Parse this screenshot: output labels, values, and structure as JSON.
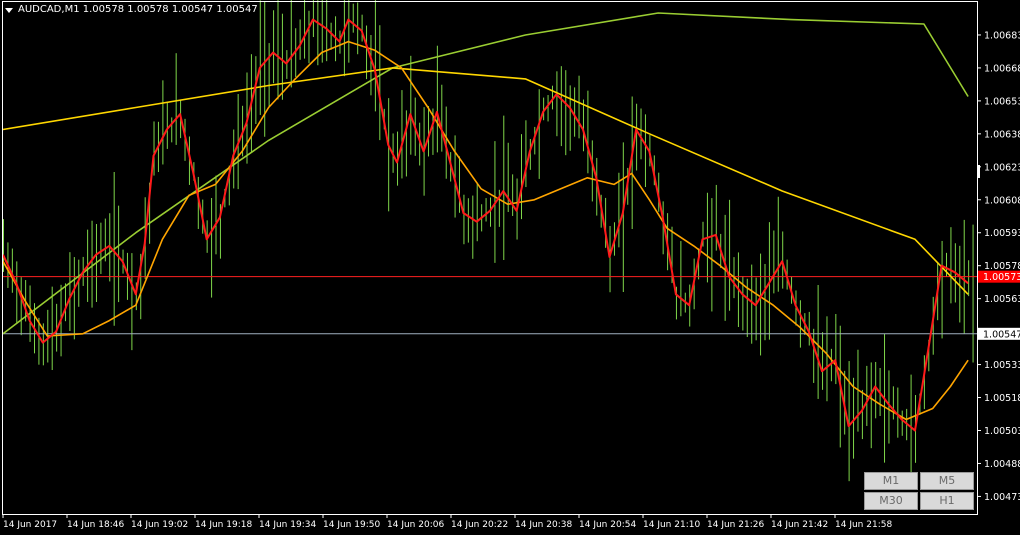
{
  "header": {
    "symbol": "AUDCAD,M1",
    "ohlc": "1.00578 1.00578 1.00547 1.00547"
  },
  "timeframes": [
    "M1",
    "M5",
    "M30",
    "H1"
  ],
  "colors": {
    "background": "#000000",
    "bars": "#7fd64a",
    "grid_frame": "#ffffff",
    "ma_fast": "#ff1a1a",
    "ma_mid": "#ffa500",
    "ma_slow": "#ffd700",
    "ma_long": "#9acd32",
    "bid_line": "#ff2020",
    "ask_line": "#a0b0c0"
  },
  "chart_data": {
    "type": "line",
    "title": "AUDCAD,M1",
    "y_ticks": [
      "1.00683",
      "1.00668",
      "1.00653",
      "1.00638",
      "1.00623",
      "1.00608",
      "1.00593",
      "1.00578",
      "1.00563",
      "1.00547",
      "1.00533",
      "1.00518",
      "1.00503",
      "1.00488",
      "1.00473"
    ],
    "ylim": [
      1.00465,
      1.00698
    ],
    "x_tick_labels": [
      "14 Jun 2017",
      "14 Jun 18:46",
      "14 Jun 19:02",
      "14 Jun 19:18",
      "14 Jun 19:34",
      "14 Jun 19:50",
      "14 Jun 20:06",
      "14 Jun 20:22",
      "14 Jun 20:38",
      "14 Jun 20:54",
      "14 Jun 21:10",
      "14 Jun 21:26",
      "14 Jun 21:42",
      "14 Jun 21:58"
    ],
    "current_bid": 1.00573,
    "current_bid_label": "1.00573",
    "ask_level": 1.00547,
    "ask_label": "1.00547",
    "series": [
      {
        "id": "ma_fast",
        "color": "#ff1a1a",
        "points": [
          [
            0,
            1.00583
          ],
          [
            3,
            1.0057
          ],
          [
            6,
            1.00553
          ],
          [
            9,
            1.00543
          ],
          [
            12,
            1.00548
          ],
          [
            15,
            1.00563
          ],
          [
            18,
            1.00575
          ],
          [
            21,
            1.00583
          ],
          [
            24,
            1.00587
          ],
          [
            27,
            1.0058
          ],
          [
            30,
            1.00565
          ],
          [
            32,
            1.00588
          ],
          [
            34,
            1.00628
          ],
          [
            37,
            1.0064
          ],
          [
            40,
            1.00647
          ],
          [
            43,
            1.0062
          ],
          [
            46,
            1.0059
          ],
          [
            49,
            1.006
          ],
          [
            52,
            1.00628
          ],
          [
            55,
            1.00643
          ],
          [
            58,
            1.00668
          ],
          [
            61,
            1.00675
          ],
          [
            64,
            1.0067
          ],
          [
            67,
            1.00678
          ],
          [
            70,
            1.0069
          ],
          [
            73,
            1.00686
          ],
          [
            76,
            1.0068
          ],
          [
            78,
            1.0069
          ],
          [
            81,
            1.00685
          ],
          [
            84,
            1.00667
          ],
          [
            87,
            1.00633
          ],
          [
            89,
            1.00625
          ],
          [
            92,
            1.00647
          ],
          [
            95,
            1.0063
          ],
          [
            98,
            1.00648
          ],
          [
            101,
            1.00625
          ],
          [
            104,
            1.00602
          ],
          [
            107,
            1.00598
          ],
          [
            110,
            1.00603
          ],
          [
            113,
            1.00612
          ],
          [
            116,
            1.00603
          ],
          [
            119,
            1.0063
          ],
          [
            122,
            1.00648
          ],
          [
            125,
            1.00656
          ],
          [
            128,
            1.0065
          ],
          [
            131,
            1.0064
          ],
          [
            134,
            1.00618
          ],
          [
            137,
            1.00582
          ],
          [
            140,
            1.00602
          ],
          [
            143,
            1.0064
          ],
          [
            146,
            1.0063
          ],
          [
            149,
            1.006
          ],
          [
            152,
            1.00565
          ],
          [
            155,
            1.0056
          ],
          [
            158,
            1.0059
          ],
          [
            161,
            1.00592
          ],
          [
            164,
            1.00573
          ],
          [
            167,
            1.00565
          ],
          [
            170,
            1.0056
          ],
          [
            173,
            1.0057
          ],
          [
            176,
            1.0058
          ],
          [
            179,
            1.0056
          ],
          [
            182,
            1.00548
          ],
          [
            185,
            1.0053
          ],
          [
            188,
            1.00535
          ],
          [
            191,
            1.00505
          ],
          [
            194,
            1.00512
          ],
          [
            197,
            1.00523
          ],
          [
            200,
            1.00515
          ],
          [
            203,
            1.00508
          ],
          [
            206,
            1.00503
          ],
          [
            209,
            1.0054
          ],
          [
            212,
            1.00578
          ],
          [
            215,
            1.00575
          ],
          [
            218,
            1.0057
          ]
        ]
      },
      {
        "id": "ma_mid",
        "color": "#ffa500",
        "points": [
          [
            0,
            1.0058
          ],
          [
            5,
            1.00562
          ],
          [
            10,
            1.00546
          ],
          [
            18,
            1.00547
          ],
          [
            24,
            1.00553
          ],
          [
            30,
            1.0056
          ],
          [
            36,
            1.0059
          ],
          [
            42,
            1.0061
          ],
          [
            48,
            1.00615
          ],
          [
            54,
            1.0063
          ],
          [
            60,
            1.0065
          ],
          [
            66,
            1.00663
          ],
          [
            72,
            1.00675
          ],
          [
            78,
            1.0068
          ],
          [
            84,
            1.00676
          ],
          [
            90,
            1.00668
          ],
          [
            96,
            1.0065
          ],
          [
            102,
            1.0063
          ],
          [
            108,
            1.00613
          ],
          [
            114,
            1.00606
          ],
          [
            120,
            1.00608
          ],
          [
            126,
            1.00613
          ],
          [
            132,
            1.00618
          ],
          [
            138,
            1.00615
          ],
          [
            142,
            1.0062
          ],
          [
            146,
            1.00608
          ],
          [
            150,
            1.00595
          ],
          [
            156,
            1.00587
          ],
          [
            162,
            1.00578
          ],
          [
            168,
            1.00568
          ],
          [
            174,
            1.0056
          ],
          [
            180,
            1.0055
          ],
          [
            186,
            1.00538
          ],
          [
            192,
            1.00523
          ],
          [
            198,
            1.00515
          ],
          [
            204,
            1.00508
          ],
          [
            210,
            1.00513
          ],
          [
            214,
            1.00523
          ],
          [
            218,
            1.00535
          ]
        ]
      },
      {
        "id": "ma_slow",
        "color": "#ffd700",
        "points": [
          [
            0,
            1.0064
          ],
          [
            30,
            1.0065
          ],
          [
            60,
            1.0066
          ],
          [
            88,
            1.00668
          ],
          [
            118,
            1.00663
          ],
          [
            146,
            1.00638
          ],
          [
            176,
            1.00612
          ],
          [
            206,
            1.0059
          ],
          [
            218,
            1.00565
          ]
        ]
      },
      {
        "id": "ma_long",
        "color": "#9acd32",
        "points": [
          [
            0,
            1.00547
          ],
          [
            30,
            1.00593
          ],
          [
            60,
            1.00635
          ],
          [
            88,
            1.00668
          ],
          [
            118,
            1.00683
          ],
          [
            148,
            1.00693
          ],
          [
            178,
            1.0069
          ],
          [
            208,
            1.00688
          ],
          [
            218,
            1.00655
          ]
        ]
      }
    ]
  }
}
